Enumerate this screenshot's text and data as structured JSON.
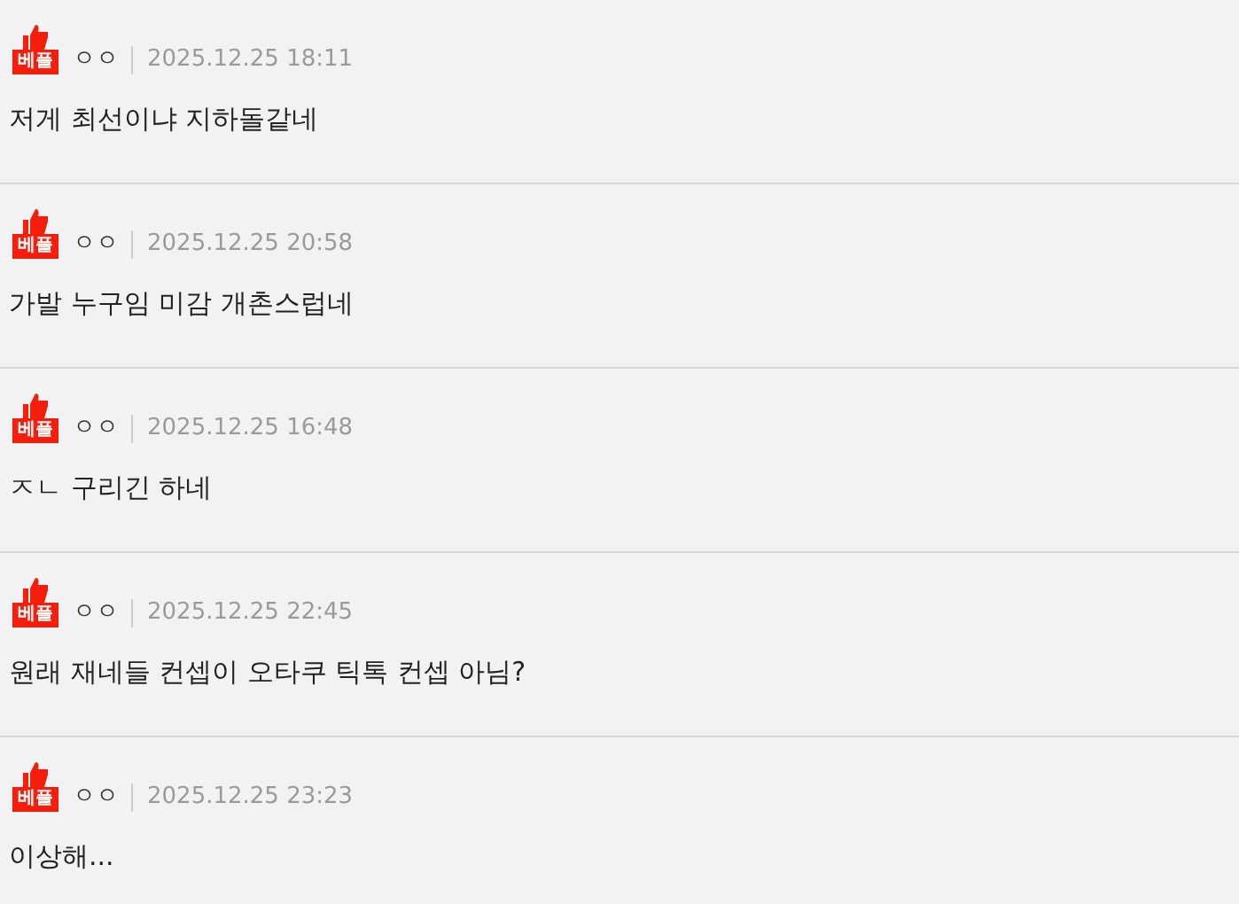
{
  "comments": [
    {
      "badge": "베플",
      "author": "ㅇㅇ",
      "date": "2025.12.25 18:11",
      "text": "저게 최선이냐 지하돌같네"
    },
    {
      "badge": "베플",
      "author": "ㅇㅇ",
      "date": "2025.12.25 20:58",
      "text": "가발 누구임 미감 개촌스럽네"
    },
    {
      "badge": "베플",
      "author": "ㅇㅇ",
      "date": "2025.12.25 16:48",
      "text": "ㅈㄴ 구리긴 하네"
    },
    {
      "badge": "베플",
      "author": "ㅇㅇ",
      "date": "2025.12.25 22:45",
      "text": "원래 재네들 컨셉이 오타쿠 틱톡 컨셉 아님?"
    },
    {
      "badge": "베플",
      "author": "ㅇㅇ",
      "date": "2025.12.25 23:23",
      "text": "이상해..."
    }
  ]
}
